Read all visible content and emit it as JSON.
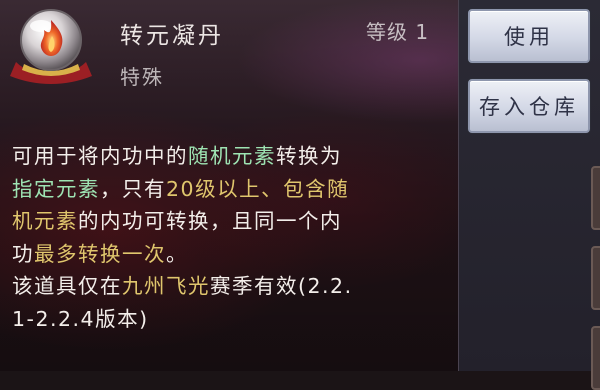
{
  "item": {
    "name": "转元凝丹",
    "level_label": "等级 1",
    "type_label": "特殊",
    "icon": "red-gem-orb-icon"
  },
  "description": {
    "line1": {
      "p1": "可用于将内功中的",
      "h1": "随机元素",
      "p2": "转换为"
    },
    "line2": {
      "h1": "指定元素",
      "p1": "，只有",
      "h2": "20级以上、包含随"
    },
    "line3": {
      "h1": "机元素",
      "p1": "的内功可转换，且同一个内"
    },
    "line4": {
      "p1": "功",
      "h1": "最多转换一次",
      "p2": "。"
    },
    "line5": {
      "p1": "该道具仅在",
      "h1": "九州飞光",
      "p2": "赛季有效(2.2."
    },
    "line6": {
      "p1": "1-2.2.4版本)"
    }
  },
  "actions": {
    "use_label": "使用",
    "store_label": "存入仓库"
  },
  "colors": {
    "highlight_green": "#9ee4b3",
    "highlight_gold": "#e0c66d",
    "body_text": "#f3eeea"
  }
}
